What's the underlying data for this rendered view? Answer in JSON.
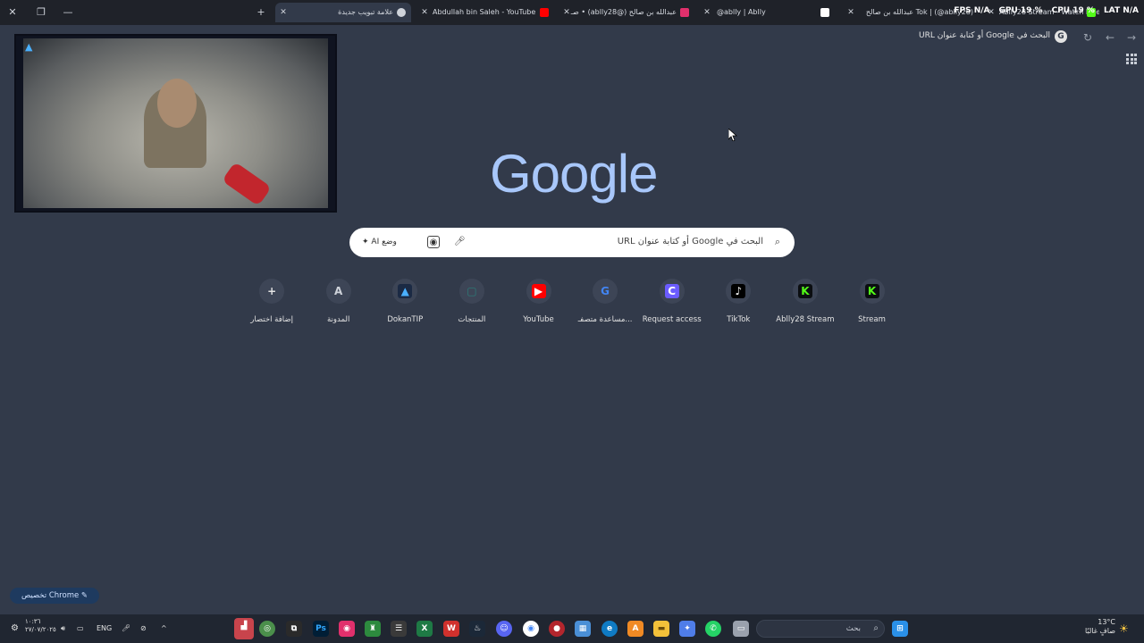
{
  "tabs": [
    {
      "title": "علامة تبويب جديدة",
      "active": true
    },
    {
      "title": "Abdullah bin Saleh - YouTube",
      "active": false
    },
    {
      "title": "عبدالله بن صالح (@ablly28) • صـ",
      "active": false
    },
    {
      "title": "@ablly | Ablly",
      "active": false
    },
    {
      "title": "Tok | (@ablly28) عبدالله بن صالح",
      "active": false
    },
    {
      "title": "Ablly28 Stream - Watch Live",
      "active": false
    }
  ],
  "overlay_stats": {
    "fps": "FPS N/A",
    "gpu": "GPU 19 %",
    "cpu": "CPU 19 %",
    "lat": "LAT N/A"
  },
  "omnibox": {
    "text": "البحث في Google أو كتابة عنوان URL"
  },
  "logo": "Google",
  "search": {
    "placeholder": "البحث في Google أو كتابة عنوان URL",
    "ai_mode": "وضع AI"
  },
  "shortcuts": [
    {
      "label": "Stream",
      "glyph": "K",
      "color": "#53fc18",
      "bg": "#0b0e11"
    },
    {
      "label": "Ablly28 Stream",
      "glyph": "K",
      "color": "#53fc18",
      "bg": "#0b0e11"
    },
    {
      "label": "TikTok",
      "glyph": "♪",
      "color": "#ffffff",
      "bg": "#000000"
    },
    {
      "label": "Request access",
      "glyph": "C",
      "color": "#ffffff",
      "bg": "#6b5cff"
    },
    {
      "label": "مساعدة متصفـ...",
      "glyph": "G",
      "color": "#4285f4",
      "bg": "#3d4556"
    },
    {
      "label": "YouTube",
      "glyph": "▶",
      "color": "#ffffff",
      "bg": "#ff0000"
    },
    {
      "label": "المنتجات",
      "glyph": "▢",
      "color": "#2a7f7a",
      "bg": "#3d4556"
    },
    {
      "label": "DokanTIP",
      "glyph": "▲",
      "color": "#4ab0ff",
      "bg": "#1b2a44"
    },
    {
      "label": "المدونة",
      "glyph": "A",
      "color": "#cfd3da",
      "bg": "#3d4556"
    },
    {
      "label": "إضافة اختصار",
      "glyph": "+",
      "color": "#e3e3e3",
      "bg": "#3d4556"
    }
  ],
  "customize": {
    "label": "تخصيص Chrome"
  },
  "taskbar": {
    "search_placeholder": "بحث",
    "lang": "ENG",
    "time": "١٠:٣٦",
    "date": "٢٧/٠٧/٢٠٢٥",
    "weather_temp": "13°C",
    "weather_desc": "صافٍ غالبًا"
  }
}
